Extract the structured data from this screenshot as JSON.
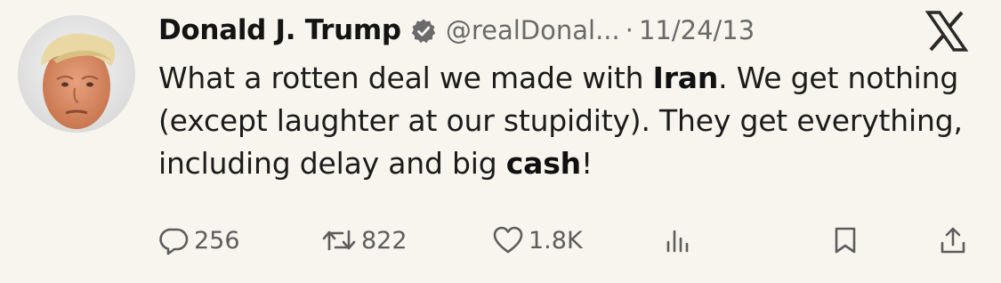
{
  "tweet": {
    "author_name": "Donald J. Trump",
    "handle": "@realDonal...",
    "separator": "·",
    "date": "11/24/13",
    "text": {
      "p1": "What a rotten deal we made with ",
      "b1": "Iran",
      "p2": ". We get nothing (except laughter at our stupidity). They get everything, including delay and big ",
      "b2": "cash",
      "p3": "!"
    }
  },
  "actions": {
    "reply_count": "256",
    "retweet_count": "822",
    "like_count": "1.8K"
  },
  "icons": {
    "verified": "verified-badge-icon",
    "platform": "x-logo-icon",
    "reply": "reply-icon",
    "retweet": "retweet-icon",
    "like": "heart-icon",
    "views": "views-icon",
    "bookmark": "bookmark-icon",
    "share": "share-icon"
  },
  "colors": {
    "background": "#f7f5ed",
    "text": "#1c1c1c",
    "muted": "#6a6a6a",
    "icon": "#5d5d5d"
  }
}
